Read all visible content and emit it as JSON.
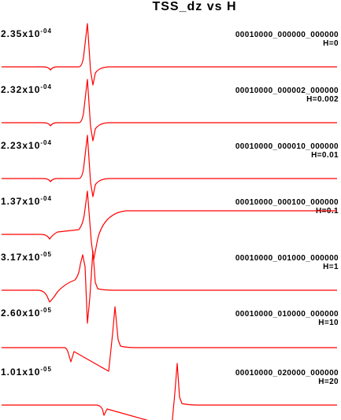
{
  "chart_data": {
    "type": "line",
    "title": "TSS_dz vs H",
    "line_color": "#ff0000",
    "series": [
      {
        "scale_base": "2.35x10",
        "scale_exp": "-04",
        "code": "00010000_000000_000000",
        "h_label": "H=0"
      },
      {
        "scale_base": "2.32x10",
        "scale_exp": "-04",
        "code": "00010000_000002_000000",
        "h_label": "H=0.002"
      },
      {
        "scale_base": "2.23x10",
        "scale_exp": "-04",
        "code": "00010000_000010_000000",
        "h_label": "H=0.01"
      },
      {
        "scale_base": "1.37x10",
        "scale_exp": "-04",
        "code": "00010000_000100_000000",
        "h_label": "H=0.1"
      },
      {
        "scale_base": "3.17x10",
        "scale_exp": "-05",
        "code": "00010000_001000_000000",
        "h_label": "H=1"
      },
      {
        "scale_base": "2.60x10",
        "scale_exp": "-05",
        "code": "00010000_010000_000000",
        "h_label": "H=10"
      },
      {
        "scale_base": "1.01x10",
        "scale_exp": "-05",
        "code": "00010000_020000_000000",
        "h_label": "H=20"
      }
    ]
  }
}
